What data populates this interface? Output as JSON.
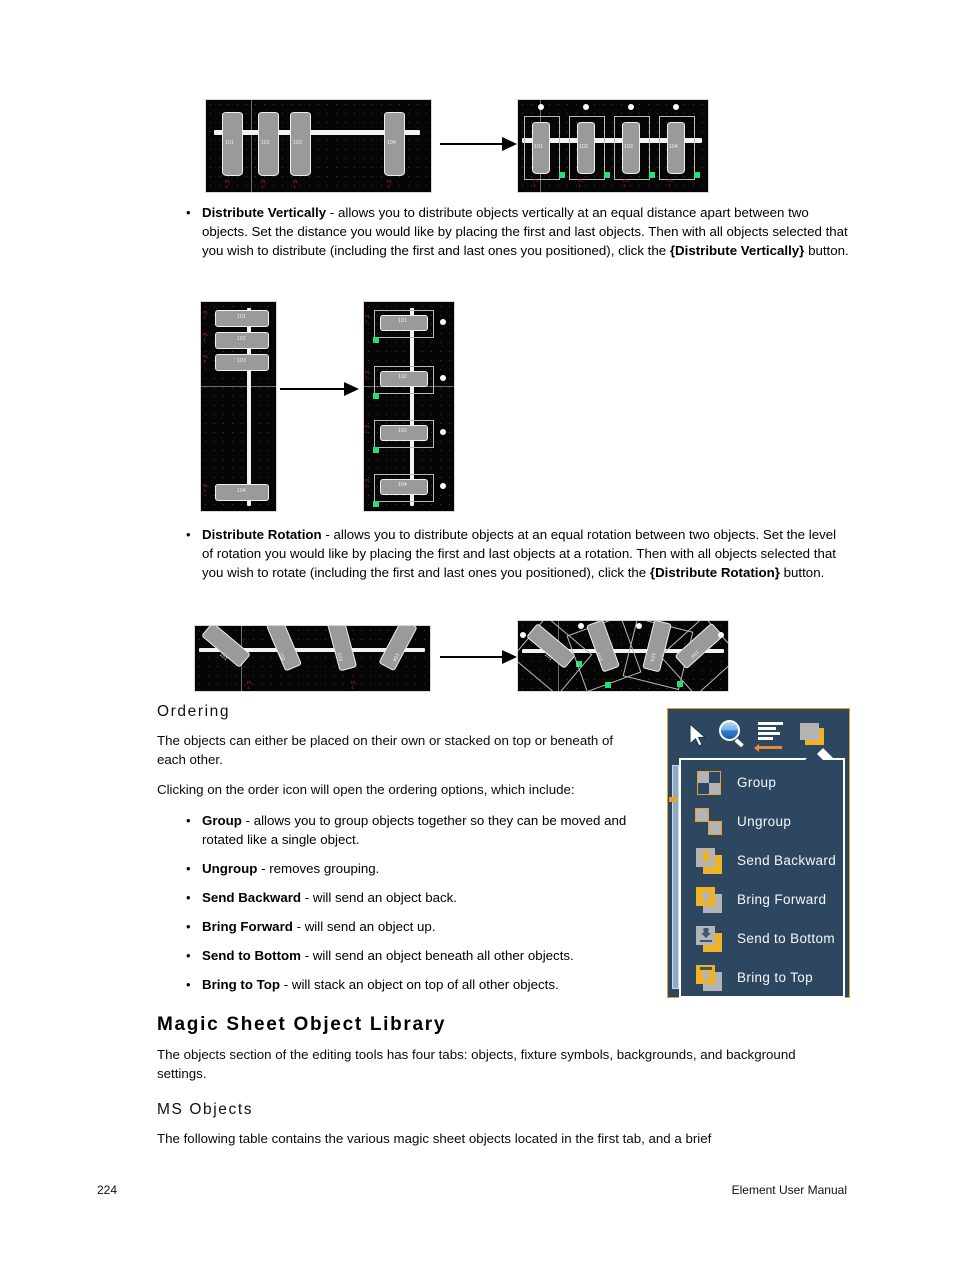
{
  "document": {
    "page_number": "224",
    "manual_title": "Element User Manual"
  },
  "sections": {
    "distribute_vertically": {
      "term": "Distribute Vertically",
      "text_part1": " - allows you to distribute objects vertically at an equal distance apart between two objects. Set the distance you would like by placing the first and last objects. Then with all objects selected that you wish to distribute (including the first and last ones you positioned), click the ",
      "button_ref": "{Distribute Vertically}",
      "text_part2": " button."
    },
    "distribute_rotation": {
      "term": "Distribute Rotation",
      "text_part1": " - allows you to distribute objects at an equal rotation between two objects. Set the level of rotation you would like by placing the first and last objects at a rotation. Then with all objects selected that you wish to rotate (including the first and last ones you positioned), click the ",
      "button_ref": "{Distribute Rotation}",
      "text_part2": " button."
    },
    "ordering": {
      "heading": "Ordering",
      "intro": "The objects can either be placed on their own or stacked on top or beneath of each other.",
      "lead_in": "Clicking on the order icon will open the ordering options, which include:",
      "items": [
        {
          "term": "Group",
          "desc": " - allows you to group objects together so they can be moved and rotated like a single object."
        },
        {
          "term": "Ungroup",
          "desc": " - removes grouping."
        },
        {
          "term": "Send Backward",
          "desc": " - will send an object back."
        },
        {
          "term": "Bring Forward",
          "desc": " - will send an object up."
        },
        {
          "term": "Send to Bottom",
          "desc": " - will send an object beneath all other objects."
        },
        {
          "term": "Bring to Top",
          "desc": " - will stack an object on top of all other objects."
        }
      ]
    },
    "magic_sheet_object_library": {
      "heading": "Magic Sheet Object Library",
      "paragraph": "The objects section of the editing tools has four tabs: objects, fixture symbols, backgrounds, and background settings."
    },
    "ms_objects": {
      "heading": "MS Objects",
      "paragraph": "The following table contains the various magic sheet objects located in the first tab, and a brief"
    }
  },
  "ui_panel": {
    "toolbar": [
      {
        "name": "select-tool",
        "icon": "cursor-icon"
      },
      {
        "name": "zoom-tool",
        "icon": "magnifier-icon"
      },
      {
        "name": "align-tool",
        "icon": "align-icon"
      },
      {
        "name": "order-tool",
        "icon": "order-icon"
      }
    ],
    "dropdown_items": [
      {
        "label": "Group",
        "icon": "group-icon"
      },
      {
        "label": "Ungroup",
        "icon": "ungroup-icon"
      },
      {
        "label": "Send Backward",
        "icon": "send-backward-icon"
      },
      {
        "label": "Bring Forward",
        "icon": "bring-forward-icon"
      },
      {
        "label": "Send to Bottom",
        "icon": "send-to-bottom-icon"
      },
      {
        "label": "Bring to Top",
        "icon": "bring-to-top-icon"
      }
    ],
    "colors": {
      "panel_bg": "#2e4760",
      "accent": "#e8a12c",
      "layer_yellow": "#f0b323",
      "layer_gray": "#b4b4b4",
      "text": "#f4f7fa"
    }
  },
  "figures": {
    "horizontal_distribute": {
      "before_channels": [
        "101",
        "102",
        "103",
        "104"
      ],
      "after_channels": [
        "101",
        "102",
        "103",
        "104"
      ],
      "fixture_sublabel": "PL\n1"
    },
    "vertical_distribute": {
      "before_channels": [
        "101",
        "102",
        "103",
        "104"
      ],
      "after_channels": [
        "101",
        "102",
        "103",
        "104"
      ],
      "fixture_sublabel": "PL\n1"
    },
    "rotation_distribute": {
      "before_channels": [
        "101",
        "102",
        "103",
        "104"
      ],
      "after_channels": [
        "101",
        "102",
        "103",
        "104"
      ],
      "fixture_sublabel": "PL\n1"
    }
  }
}
